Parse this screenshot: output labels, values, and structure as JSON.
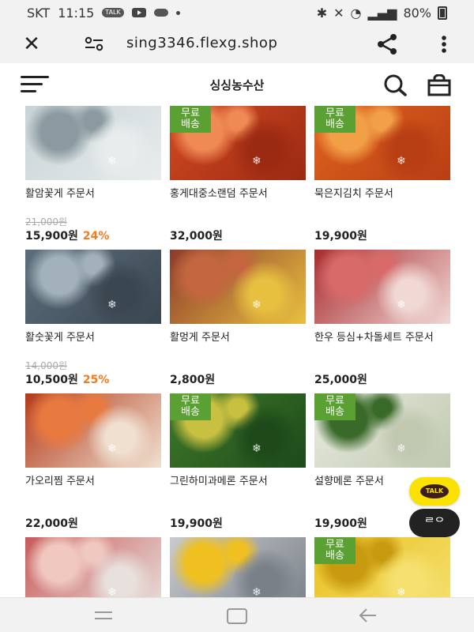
{
  "status_bar": {
    "carrier": "SKT",
    "time": "11:15",
    "talk_badge": "TALK",
    "battery": "80%"
  },
  "browser": {
    "url": "sing3346.flexg.shop",
    "icons": [
      "close-icon",
      "site-info-icon",
      "share-icon",
      "more-vert-icon"
    ]
  },
  "site": {
    "title": "싱싱농수산",
    "icons": [
      "menu-icon",
      "search-icon",
      "cart-icon"
    ]
  },
  "free_shipping_label": "무료\n배송",
  "products": [
    {
      "name": "활암꽃게 주문서",
      "original_price": "21,000원",
      "price": "15,900원",
      "discount": "24%",
      "free_shipping": false,
      "image": "crabs-on-ice",
      "colors": [
        "#c9d3d6",
        "#8a9aa0",
        "#e8ecec"
      ]
    },
    {
      "name": "홍게대중소랜덤 주문서",
      "original_price": "",
      "price": "32,000원",
      "discount": "",
      "free_shipping": true,
      "image": "red-snow-crabs",
      "colors": [
        "#d24a22",
        "#f08a55",
        "#9b2a12"
      ]
    },
    {
      "name": "묵은지김치 주문서",
      "original_price": "",
      "price": "19,900원",
      "discount": "",
      "free_shipping": true,
      "image": "aged-kimchi",
      "colors": [
        "#e0641e",
        "#f2a048",
        "#b83e14"
      ]
    },
    {
      "name": "활숫꽃게 주문서",
      "original_price": "14,000원",
      "price": "10,500원",
      "discount": "25%",
      "free_shipping": false,
      "image": "live-crabs-hands",
      "colors": [
        "#5c6e7c",
        "#a3b2ba",
        "#3a4650"
      ]
    },
    {
      "name": "활멍게 주문서",
      "original_price": "",
      "price": "2,800원",
      "discount": "",
      "free_shipping": false,
      "image": "sea-squirts",
      "colors": [
        "#8c3a2c",
        "#c46640",
        "#e8c040"
      ]
    },
    {
      "name": "한우 등심+차돌세트 주문서",
      "original_price": "",
      "price": "25,000원",
      "discount": "",
      "free_shipping": false,
      "image": "hanwoo-beef",
      "colors": [
        "#a82a2e",
        "#d86a6a",
        "#f0d8d4"
      ]
    },
    {
      "name": "가오리찜 주문서",
      "original_price": "",
      "price": "22,000원",
      "discount": "",
      "free_shipping": false,
      "image": "braised-crab",
      "colors": [
        "#b23a1a",
        "#e87a40",
        "#f0e0d0"
      ]
    },
    {
      "name": "그린하미과메론 주문서",
      "original_price": "",
      "price": "19,900원",
      "discount": "",
      "free_shipping": true,
      "image": "green-melons",
      "colors": [
        "#3f7a2a",
        "#c8c040",
        "#1e4a1a"
      ]
    },
    {
      "name": "설향메론 주문서",
      "original_price": "",
      "price": "19,900원",
      "discount": "",
      "free_shipping": true,
      "image": "white-melons",
      "colors": [
        "#e8ece0",
        "#3a6a2a",
        "#c0c8b0"
      ]
    },
    {
      "name": "",
      "original_price": "",
      "price": "",
      "discount": "",
      "free_shipping": false,
      "image": "beef-slices",
      "colors": [
        "#c85a5a",
        "#f0c8c0",
        "#e8e0dc"
      ]
    },
    {
      "name": "",
      "original_price": "",
      "price": "",
      "discount": "",
      "free_shipping": false,
      "image": "dried-fish-lemon",
      "colors": [
        "#c8ccd0",
        "#f0c020",
        "#7a8088"
      ]
    },
    {
      "name": "",
      "original_price": "",
      "price": "",
      "discount": "",
      "free_shipping": true,
      "image": "yellow-fruits",
      "colors": [
        "#e8c020",
        "#c89a10",
        "#f5e070"
      ]
    }
  ],
  "floating": {
    "kakao_talk_label": "TALK",
    "riding_label": "ᄅᄋ"
  },
  "nav_bar": {
    "icons": [
      "recents-icon",
      "home-icon",
      "back-icon"
    ]
  }
}
